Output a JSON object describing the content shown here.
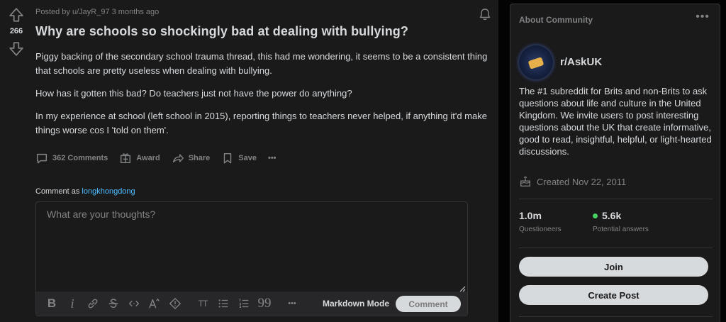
{
  "post": {
    "score": "266",
    "meta": "Posted by u/JayR_97 3 months ago",
    "title": "Why are schools so shockingly bad at dealing with bullying?",
    "paragraphs": [
      "Piggy backing of the secondary school trauma thread, this had me wondering, it seems to be a consistent thing that schools are pretty useless when dealing with bullying.",
      "How has it gotten this bad? Do teachers just not have the power do anything?",
      "In my experience at school (left school in 2015), reporting things to teachers never helped, if anything it'd make things worse cos I 'told on them'."
    ],
    "actions": {
      "comments": "362 Comments",
      "award": "Award",
      "share": "Share",
      "save": "Save",
      "more": "•••"
    }
  },
  "comment_box": {
    "label_prefix": "Comment as",
    "username": "longkhongdong",
    "placeholder": "What are your thoughts?",
    "toolbar": {
      "bold": "B",
      "italic": "i",
      "heading": "TT",
      "quote": "99",
      "more": "•••",
      "markdown_mode": "Markdown Mode",
      "submit": "Comment"
    }
  },
  "sidebar": {
    "header": "About Community",
    "menu": "•••",
    "community_name": "r/AskUK",
    "description": "The #1 subreddit for Brits and non-Brits to ask questions about life and culture in the United Kingdom. We invite users to post interesting questions about the UK that create informative, good to read, insightful, helpful, or light-hearted discussions.",
    "created": "Created Nov 22, 2011",
    "members": {
      "value": "1.0m",
      "label": "Questioneers"
    },
    "online": {
      "value": "5.6k",
      "label": "Potential answers"
    },
    "join_label": "Join",
    "create_post_label": "Create Post"
  },
  "colors": {
    "background": "#030303",
    "card": "#1a1a1b",
    "text": "#d7dadc",
    "muted": "#818384",
    "link": "#4fbcff",
    "online_dot": "#46d160"
  }
}
